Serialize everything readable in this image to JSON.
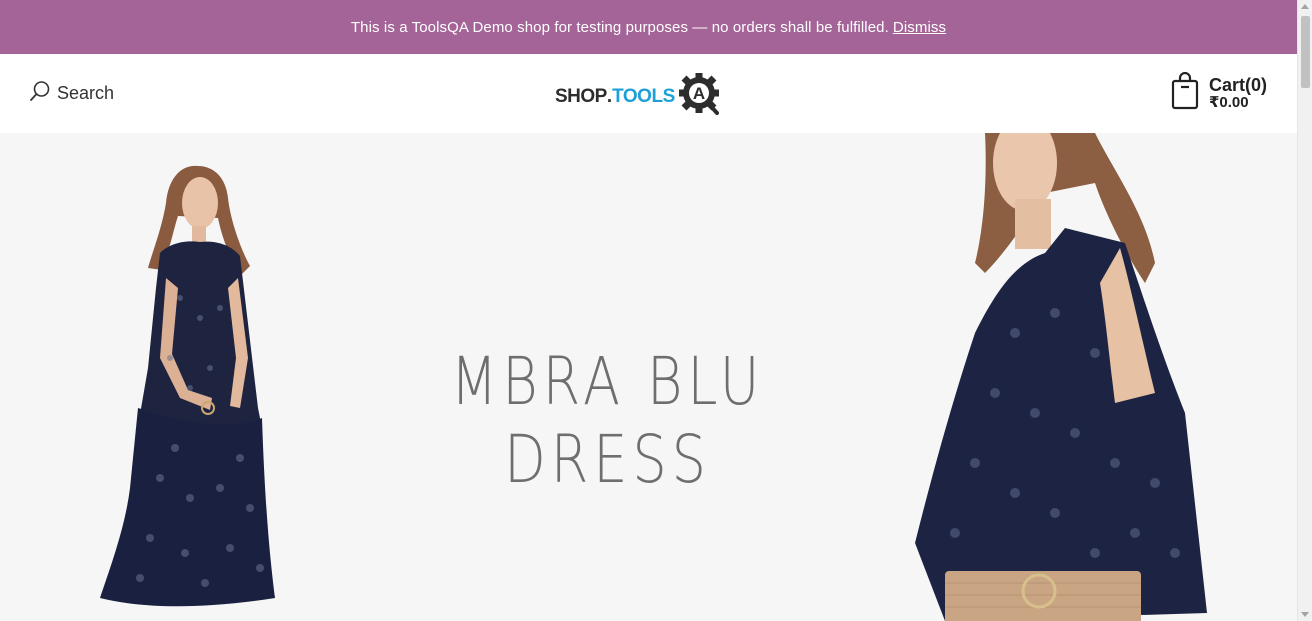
{
  "store_notice": {
    "message": "This is a ToolsQA Demo shop for testing purposes — no orders shall be fulfilled.",
    "dismiss_label": "Dismiss",
    "background_color": "#a46497"
  },
  "header": {
    "search_label": "Search",
    "search_icon": "search-icon",
    "logo": {
      "part1": "SHOP",
      "part2": ".",
      "part3": "TOOLS",
      "gear_letter": "A",
      "accent_color": "#1d9fd8"
    },
    "cart": {
      "label": "Cart(0)",
      "amount": "₹0.00",
      "icon": "shopping-bag-icon"
    }
  },
  "hero": {
    "title_line1": "MBRA BLU",
    "title_line2": "DRESS",
    "background_color": "#f6f6f6"
  }
}
